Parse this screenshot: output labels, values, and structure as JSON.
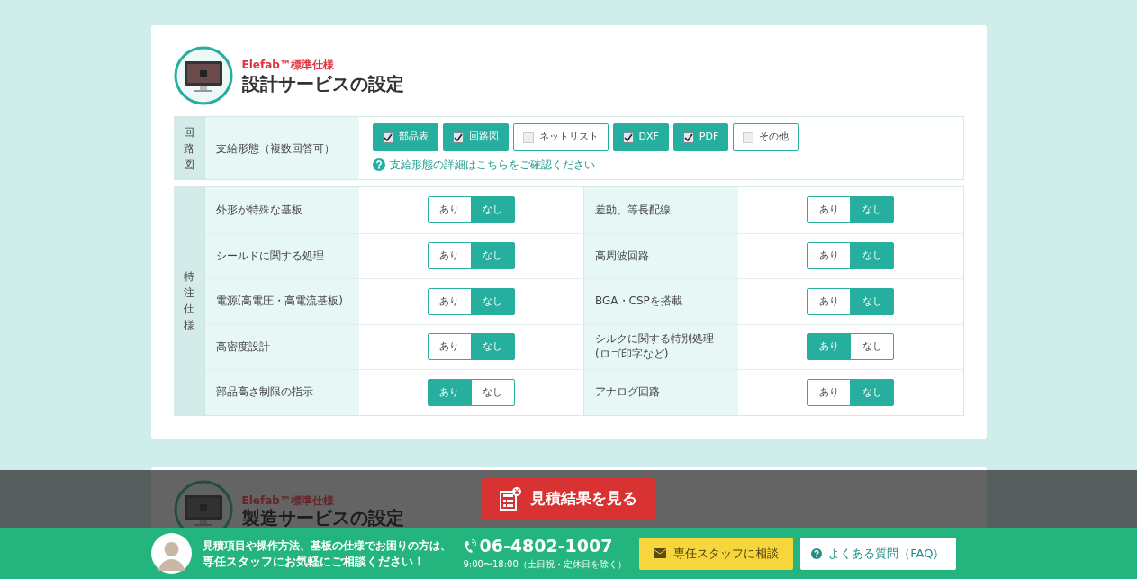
{
  "design_section": {
    "brand": "Elefab™標準仕様",
    "title": "設計サービスの設定",
    "supply": {
      "group": "回路図",
      "label": "支給形態（複数回答可）",
      "options": [
        {
          "label": "部品表",
          "checked": true
        },
        {
          "label": "回路図",
          "checked": true
        },
        {
          "label": "ネットリスト",
          "checked": false
        },
        {
          "label": "DXF",
          "checked": true
        },
        {
          "label": "PDF",
          "checked": true
        },
        {
          "label": "その他",
          "checked": false
        }
      ],
      "help_link": "支給形態の詳細はこちらをご確認ください"
    },
    "special": {
      "group": "特注仕様",
      "rows": [
        [
          {
            "label": "外形が特殊な基板",
            "options": [
              {
                "label": "あり",
                "selected": false
              },
              {
                "label": "なし",
                "selected": true
              }
            ]
          },
          {
            "label": "差動、等長配線",
            "options": [
              {
                "label": "あり",
                "selected": false
              },
              {
                "label": "なし",
                "selected": true
              }
            ]
          }
        ],
        [
          {
            "label": "シールドに関する処理",
            "options": [
              {
                "label": "あり",
                "selected": false
              },
              {
                "label": "なし",
                "selected": true
              }
            ]
          },
          {
            "label": "高周波回路",
            "options": [
              {
                "label": "あり",
                "selected": false
              },
              {
                "label": "なし",
                "selected": true
              }
            ]
          }
        ],
        [
          {
            "label": "電源(高電圧・高電流基板)",
            "options": [
              {
                "label": "あり",
                "selected": false
              },
              {
                "label": "なし",
                "selected": true
              }
            ]
          },
          {
            "label": "BGA・CSPを搭載",
            "options": [
              {
                "label": "あり",
                "selected": false
              },
              {
                "label": "なし",
                "selected": true
              }
            ]
          }
        ],
        [
          {
            "label": "高密度設計",
            "options": [
              {
                "label": "あり",
                "selected": false
              },
              {
                "label": "なし",
                "selected": true
              }
            ]
          },
          {
            "label": "シルクに関する特別処理\n(ロゴ印字など)",
            "options": [
              {
                "label": "あり",
                "selected": true
              },
              {
                "label": "なし",
                "selected": false
              }
            ]
          }
        ],
        [
          {
            "label": "部品高さ制限の指示",
            "options": [
              {
                "label": "あり",
                "selected": true
              },
              {
                "label": "なし",
                "selected": false
              }
            ]
          },
          {
            "label": "アナログ回路",
            "options": [
              {
                "label": "あり",
                "selected": false
              },
              {
                "label": "なし",
                "selected": true
              }
            ]
          }
        ]
      ]
    }
  },
  "manufacturing_section": {
    "brand": "Elefab™標準仕様",
    "title": "製造サービスの設定"
  },
  "result_button": "見積結果を見る",
  "contact_bar": {
    "message_line_1": "見積項目や操作方法、基板の仕様でお困りの方は、",
    "message_line_2": "専任スタッフにお気軽にご相談ください！",
    "phone": "06-4802-1007",
    "hours": "9:00〜18:00（土日祝・定休日を除く）",
    "staff_button": "専任スタッフに相談",
    "faq_button": "よくある質問（FAQ）"
  }
}
